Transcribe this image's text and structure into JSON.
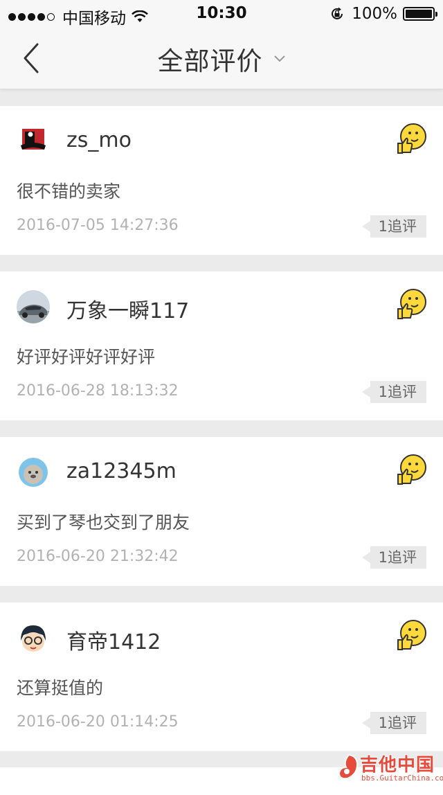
{
  "status_bar": {
    "carrier": "中国移动",
    "time": "10:30",
    "battery": "100%"
  },
  "nav": {
    "title": "全部评价"
  },
  "reviews": [
    {
      "username": "zs_mo",
      "content": "很不错的卖家",
      "date": "2016-07-05 14:27:36",
      "followup": "1追评"
    },
    {
      "username": "万象一瞬117",
      "content": "好评好评好评好评",
      "date": "2016-06-28 18:13:32",
      "followup": "1追评"
    },
    {
      "username": "za12345m",
      "content": "买到了琴也交到了朋友",
      "date": "2016-06-20 21:32:42",
      "followup": "1追评"
    },
    {
      "username": "育帝1412",
      "content": "还算挺值的",
      "date": "2016-06-20 01:14:25",
      "followup": "1追评"
    }
  ],
  "watermark": {
    "text": "吉他中国",
    "url": "bbs.GuitarChina.com"
  },
  "colors": {
    "emoji_yellow": "#ffd83b",
    "watermark_red": "#e64b3c",
    "date_gray": "#b2b2b2"
  },
  "icons": [
    "back-chevron-icon",
    "chevron-down-icon",
    "wifi-icon",
    "rotation-lock-icon",
    "battery-icon",
    "thumbs-up-emoji-icon"
  ]
}
